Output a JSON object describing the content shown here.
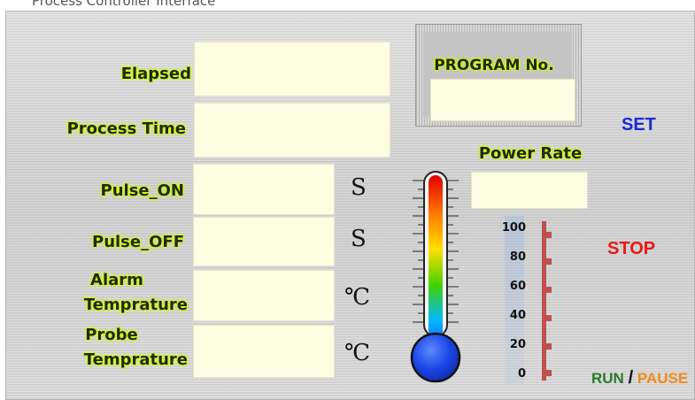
{
  "title_fragment": "Process Controller Interface",
  "labels": {
    "elapsed": "Elapsed",
    "process_time": "Process Time",
    "pulse_on": "Pulse_ON",
    "pulse_off": "Pulse_OFF",
    "alarm_temp_l1": "Alarm",
    "alarm_temp_l2": "Temprature",
    "probe_temp_l1": "Probe",
    "probe_temp_l2": "Temprature",
    "program_no": "PROGRAM No.",
    "power_rate": "Power Rate"
  },
  "units": {
    "pulse_on": "S",
    "pulse_off": "S",
    "alarm_temp": "℃",
    "probe_temp": "℃"
  },
  "fields": {
    "elapsed": "",
    "process_time": "",
    "pulse_on": "",
    "pulse_off": "",
    "alarm_temp": "",
    "probe_temp": "",
    "program_no": "",
    "power_rate": ""
  },
  "buttons": {
    "set": "SET",
    "stop": "STOP",
    "run": "RUN",
    "separator": "/",
    "pause": "PAUSE"
  },
  "scale": {
    "ticks": [
      "100",
      "80",
      "60",
      "40",
      "20",
      "0"
    ]
  },
  "colors": {
    "label_glow": "#d8ff00",
    "field_bg": "#fdfde1",
    "set": "#1a2ad6",
    "stop": "#e51a1a",
    "run": "#2a7a2a",
    "pause": "#f08a1a",
    "scale_bar": "#c0504d"
  },
  "icons": {
    "thermometer": "thermometer-icon"
  }
}
